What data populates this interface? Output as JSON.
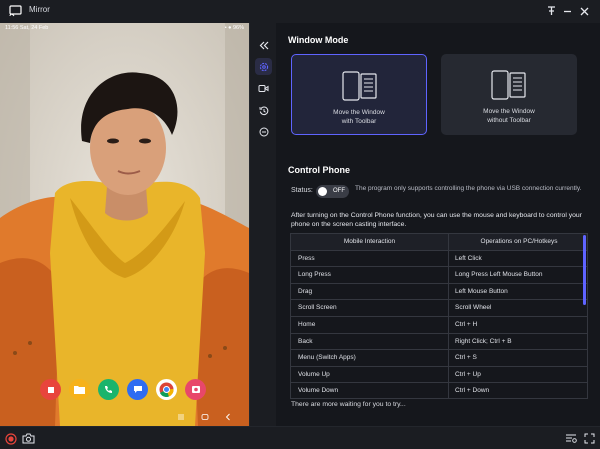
{
  "window": {
    "title": "Mirror",
    "accent_color": "#5f64ff"
  },
  "phone": {
    "status_time": "11:56 Sat, 24 Feb",
    "status_right": "• ● 96%",
    "dock_apps": [
      {
        "name": "samsung-notes-icon",
        "color": "#e8453c"
      },
      {
        "name": "my-files-icon",
        "color": "#f6b21a"
      },
      {
        "name": "phone-icon",
        "color": "#1bb46c"
      },
      {
        "name": "messages-icon",
        "color": "#2f6cf2"
      },
      {
        "name": "chrome-icon",
        "color": "#ffffff"
      },
      {
        "name": "screen-recorder-icon",
        "color": "#e8476a"
      }
    ]
  },
  "sidebar": {
    "items": [
      "collapse-icon",
      "settings-icon",
      "record-icon",
      "history-icon",
      "more-icon"
    ]
  },
  "window_mode": {
    "title": "Window Mode",
    "options": [
      {
        "label": "Move the Window\nwith Toolbar",
        "selected": true
      },
      {
        "label": "Move the Window\nwithout Toolbar",
        "selected": false
      }
    ]
  },
  "control_phone": {
    "title": "Control Phone",
    "status_label": "Status:",
    "toggle_text": "OFF",
    "status_note": "The program only supports controlling the phone via USB connection currently.",
    "intro": "After turning on the Control Phone function, you can use the mouse and keyboard to control your phone on the screen casting interface.",
    "table_headers": [
      "Mobile Interaction",
      "Operations on PC/Hotkeys"
    ],
    "table_rows": [
      [
        "Press",
        "Left Click"
      ],
      [
        "Long Press",
        "Long Press Left Mouse Button"
      ],
      [
        "Drag",
        "Left Mouse Button"
      ],
      [
        "Scroll Screen",
        "Scroll Wheel"
      ],
      [
        "Home",
        "Ctrl + H"
      ],
      [
        "Back",
        "Right Click; Ctrl + B"
      ],
      [
        "Menu (Switch Apps)",
        "Ctrl + S"
      ],
      [
        "Volume Up",
        "Ctrl + Up"
      ],
      [
        "Volume Down",
        "Ctrl + Down"
      ]
    ],
    "more_text": "There are more waiting for you to try..."
  }
}
